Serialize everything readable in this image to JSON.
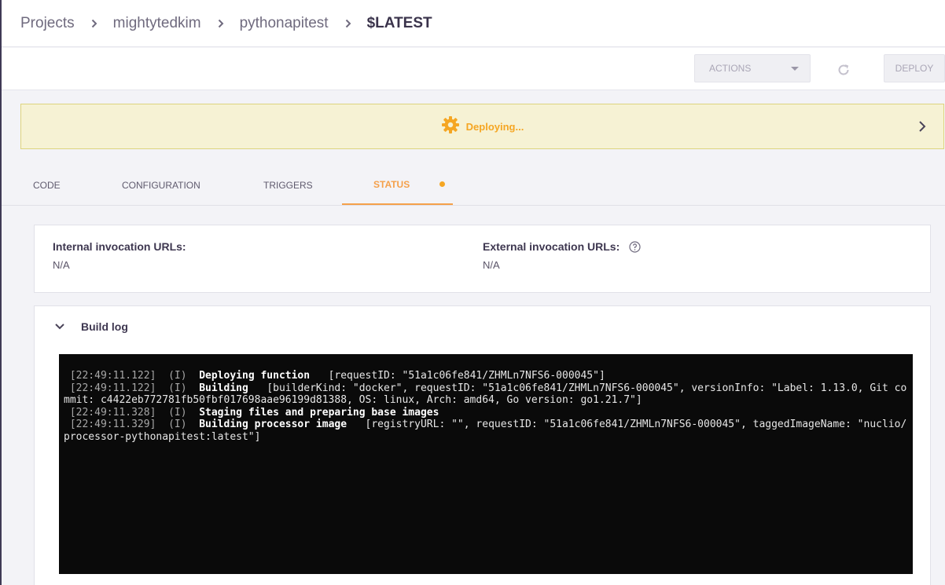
{
  "breadcrumb": {
    "items": [
      "Projects",
      "mightytedkim",
      "pythonapitest"
    ],
    "current": "$LATEST"
  },
  "toolbar": {
    "actions_label": "ACTIONS",
    "deploy_label": "DEPLOY"
  },
  "banner": {
    "status": "Deploying..."
  },
  "tabs": [
    {
      "label": "CODE"
    },
    {
      "label": "CONFIGURATION"
    },
    {
      "label": "TRIGGERS"
    },
    {
      "label": "STATUS"
    }
  ],
  "invocation": {
    "internal_label": "Internal invocation URLs:",
    "internal_value": "N/A",
    "external_label": "External invocation URLs:",
    "external_value": "N/A"
  },
  "build_log": {
    "title": "Build log",
    "lines": [
      {
        "time": "[22:49:11.122]",
        "level": "(I)",
        "message": "Deploying function",
        "context": "[requestID: \"51a1c06fe841/ZHMLn7NFS6-000045\"]"
      },
      {
        "time": "[22:49:11.122]",
        "level": "(I)",
        "message": "Building",
        "context": "[builderKind: \"docker\", requestID: \"51a1c06fe841/ZHMLn7NFS6-000045\", versionInfo: \"Label: 1.13.0, Git commit: c4422eb772781fb50fbf017698aae96199d81388, OS: linux, Arch: amd64, Go version: go1.21.7\"]"
      },
      {
        "time": "[22:49:11.328]",
        "level": "(I)",
        "message": "Staging files and preparing base images",
        "context": ""
      },
      {
        "time": "[22:49:11.329]",
        "level": "(I)",
        "message": "Building processor image",
        "context": "[registryURL: \"\", requestID: \"51a1c06fe841/ZHMLn7NFS6-000045\", taggedImageName: \"nuclio/processor-pythonapitest:latest\"]"
      }
    ]
  },
  "colors": {
    "accent": "#f5a623",
    "banner_bg": "#f6f2d4",
    "terminal_bg": "#0a0a0a"
  },
  "icons": {
    "refresh": "refresh-icon",
    "gear": "gear-icon",
    "help": "help-circle-icon"
  }
}
